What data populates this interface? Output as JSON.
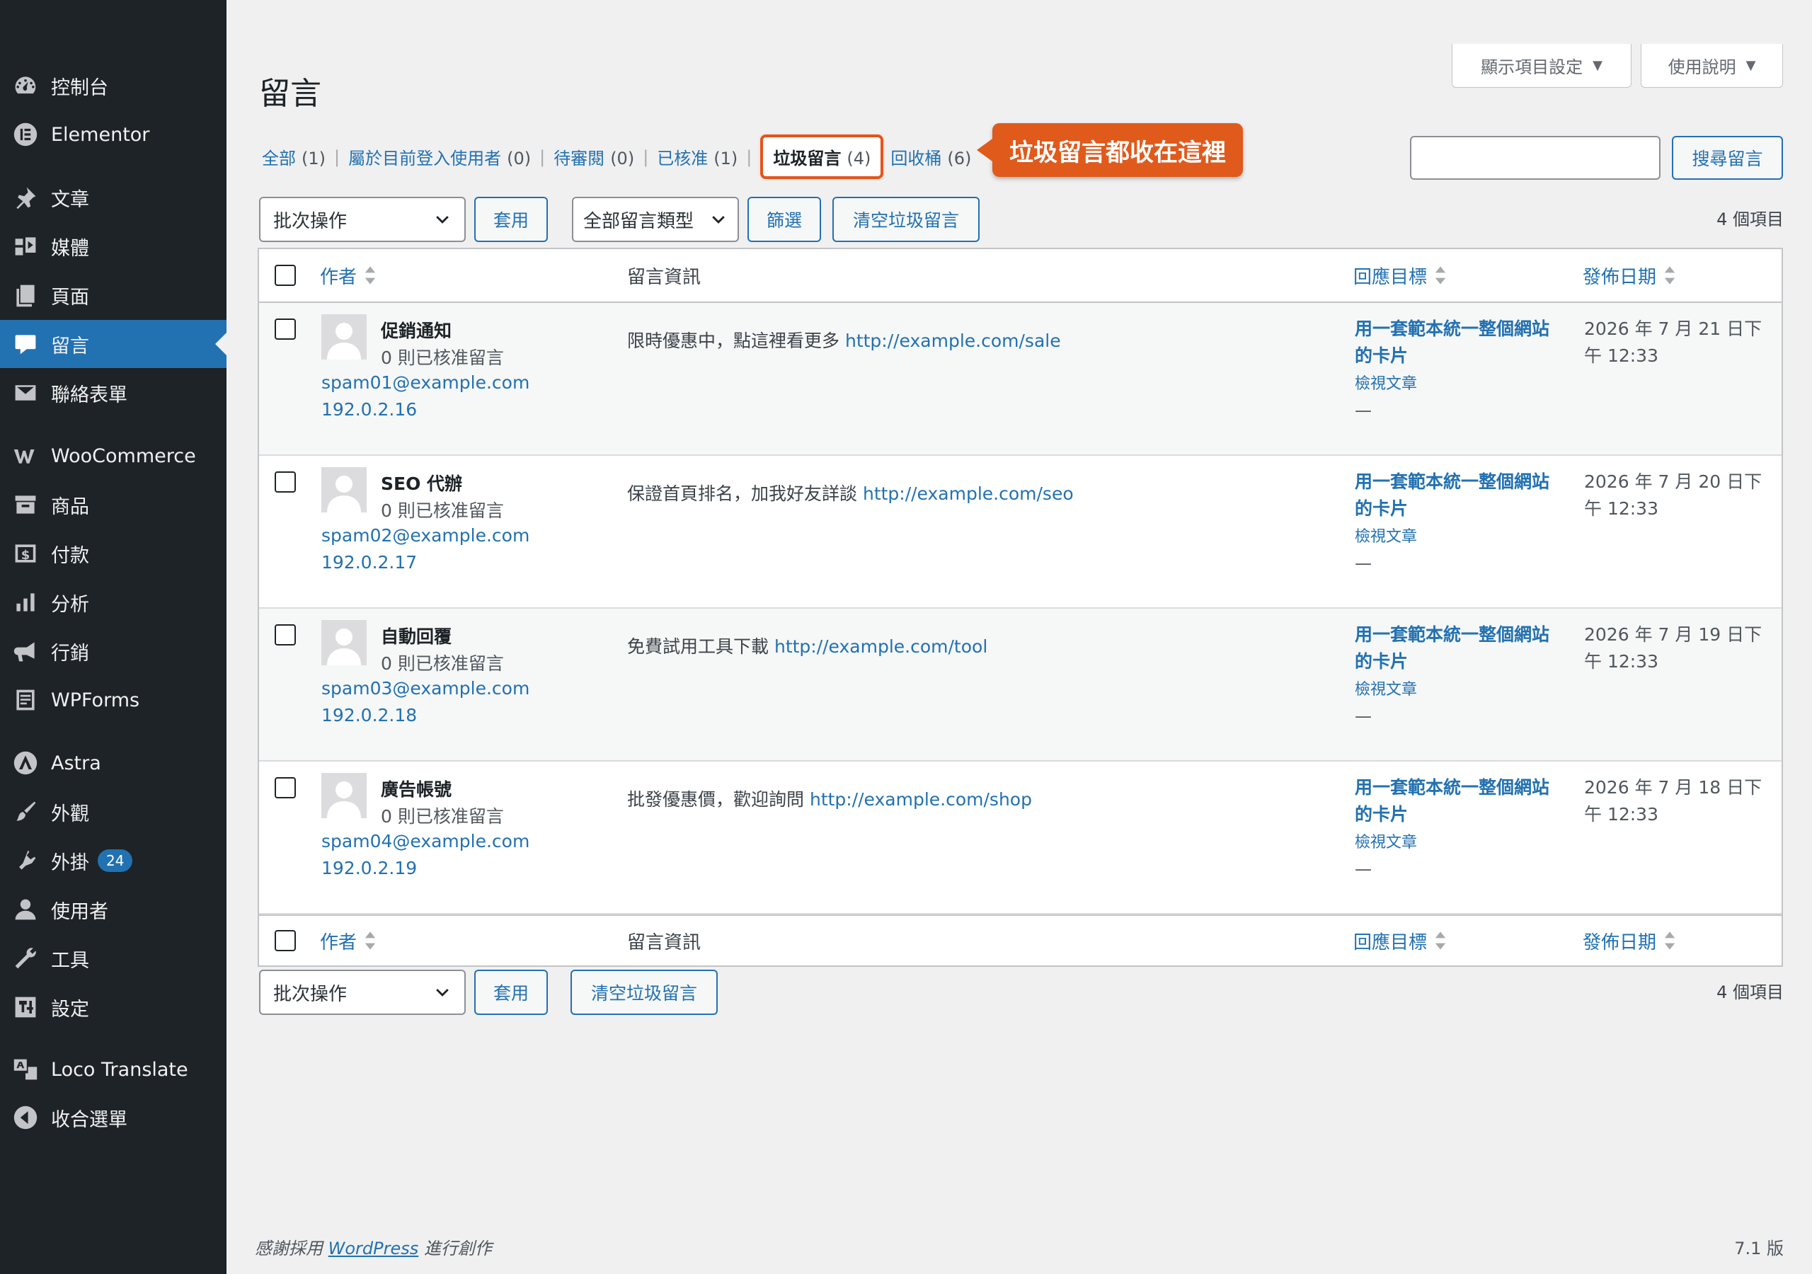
{
  "sidebar": {
    "items": [
      {
        "label": "控制台",
        "icon": "dashboard-icon"
      },
      {
        "label": "Elementor",
        "icon": "elementor-icon"
      },
      {
        "label": "文章",
        "icon": "pin-icon"
      },
      {
        "label": "媒體",
        "icon": "media-icon"
      },
      {
        "label": "頁面",
        "icon": "page-icon"
      },
      {
        "label": "留言",
        "icon": "comment-icon",
        "active": true
      },
      {
        "label": "聯絡表單",
        "icon": "mail-icon"
      },
      {
        "label": "WooCommerce",
        "icon": "woocommerce-icon"
      },
      {
        "label": "商品",
        "icon": "archive-icon"
      },
      {
        "label": "付款",
        "icon": "dollar-icon"
      },
      {
        "label": "分析",
        "icon": "bar-chart-icon"
      },
      {
        "label": "行銷",
        "icon": "megaphone-icon"
      },
      {
        "label": "WPForms",
        "icon": "form-icon"
      },
      {
        "label": "Astra",
        "icon": "astra-icon"
      },
      {
        "label": "外觀",
        "icon": "brush-icon"
      },
      {
        "label": "外掛",
        "icon": "plugin-icon",
        "badge": "24"
      },
      {
        "label": "使用者",
        "icon": "user-icon"
      },
      {
        "label": "工具",
        "icon": "wrench-icon"
      },
      {
        "label": "設定",
        "icon": "settings-icon"
      },
      {
        "label": "Loco Translate",
        "icon": "translate-icon"
      },
      {
        "label": "收合選單",
        "icon": "collapse-icon"
      }
    ]
  },
  "header": {
    "screen_options": "顯示項目設定",
    "help": "使用說明",
    "title": "留言"
  },
  "views": [
    {
      "label": "全部",
      "count": "(1)"
    },
    {
      "label": "屬於目前登入使用者",
      "count": "(0)"
    },
    {
      "label": "待審閱",
      "count": "(0)"
    },
    {
      "label": "已核准",
      "count": "(1)"
    },
    {
      "label": "垃圾留言",
      "count": "(4)",
      "current": true
    },
    {
      "label": "回收桶",
      "count": "(6)"
    }
  ],
  "callout": "垃圾留言都收在這裡",
  "search": {
    "value": "",
    "button": "搜尋留言"
  },
  "top_nav": {
    "bulk_action": "批次操作",
    "apply": "套用",
    "comment_type": "全部留言類型",
    "filter": "篩選",
    "empty_spam": "清空垃圾留言",
    "count": "4 個項目"
  },
  "columns": {
    "author": "作者",
    "comment": "留言資訊",
    "response": "回應目標",
    "date": "發佈日期"
  },
  "rows": [
    {
      "author": "促銷通知",
      "approved": "0 則已核准留言",
      "email": "spam01@example.com",
      "ip": "192.0.2.16",
      "text": "限時優惠中，點這裡看更多",
      "link": "http://example.com/sale",
      "response": "用一套範本統一整個網站的卡片",
      "view_post": "檢視文章",
      "dash": "—",
      "date": "2026 年 7 月 21 日下午 12:33"
    },
    {
      "author": "SEO 代辦",
      "approved": "0 則已核准留言",
      "email": "spam02@example.com",
      "ip": "192.0.2.17",
      "text": "保證首頁排名，加我好友詳談",
      "link": "http://example.com/seo",
      "response": "用一套範本統一整個網站的卡片",
      "view_post": "檢視文章",
      "dash": "—",
      "date": "2026 年 7 月 20 日下午 12:33"
    },
    {
      "author": "自動回覆",
      "approved": "0 則已核准留言",
      "email": "spam03@example.com",
      "ip": "192.0.2.18",
      "text": "免費試用工具下載",
      "link": "http://example.com/tool",
      "response": "用一套範本統一整個網站的卡片",
      "view_post": "檢視文章",
      "dash": "—",
      "date": "2026 年 7 月 19 日下午 12:33"
    },
    {
      "author": "廣告帳號",
      "approved": "0 則已核准留言",
      "email": "spam04@example.com",
      "ip": "192.0.2.19",
      "text": "批發優惠價，歡迎詢問",
      "link": "http://example.com/shop",
      "response": "用一套範本統一整個網站的卡片",
      "view_post": "檢視文章",
      "dash": "—",
      "date": "2026 年 7 月 18 日下午 12:33"
    }
  ],
  "bottom_nav": {
    "bulk_action": "批次操作",
    "apply": "套用",
    "empty_spam": "清空垃圾留言",
    "count": "4 個項目"
  },
  "footer": {
    "thanks_prefix": "感謝採用",
    "wordpress": "WordPress",
    "thanks_suffix": "進行創作",
    "version": "7.1 版"
  },
  "colors": {
    "accent": "#2271b1",
    "sidebar": "#1d2327",
    "callout": "#e05a1c"
  }
}
